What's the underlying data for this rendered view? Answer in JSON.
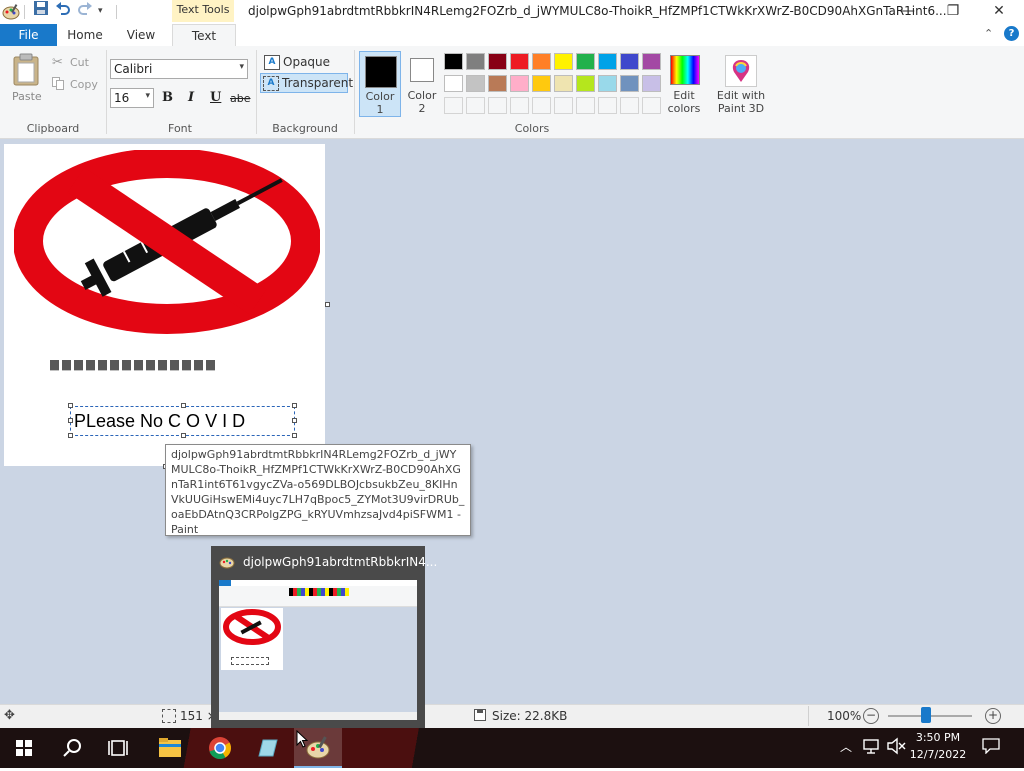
{
  "window": {
    "title": "djolpwGph91abrdtmtRbbkrIN4RLemg2FOZrb_d_jWYMULC8o-ThoikR_HfZMPf1CTWkKrXWrZ-B0CD90AhXGnTaR1int6...",
    "contextual_tab_group": "Text Tools",
    "controls": {
      "minimize": "—",
      "maximize": "❐",
      "close": "✕"
    }
  },
  "tabs": {
    "file": "File",
    "home": "Home",
    "view": "View",
    "text": "Text"
  },
  "ribbon": {
    "clipboard": {
      "paste": "Paste",
      "cut": "Cut",
      "copy": "Copy",
      "label": "Clipboard"
    },
    "font": {
      "family": "Calibri",
      "size": "16",
      "bold": "B",
      "italic": "I",
      "underline": "U",
      "strike": "abe",
      "label": "Font"
    },
    "background": {
      "opaque": "Opaque",
      "transparent": "Transparent",
      "label": "Background"
    },
    "colors": {
      "color1_line1": "Color",
      "color1_line2": "1",
      "color2_line1": "Color",
      "color2_line2": "2",
      "edit_line1": "Edit",
      "edit_line2": "colors",
      "paint3d_line1": "Edit with",
      "paint3d_line2": "Paint 3D",
      "label": "Colors",
      "color1_value": "#000000",
      "color2_value": "#ffffff",
      "palette_row1": [
        "#000000",
        "#7f7f7f",
        "#880015",
        "#ed1c24",
        "#ff7f27",
        "#fff200",
        "#22b14c",
        "#00a2e8",
        "#3f48cc",
        "#a349a4"
      ],
      "palette_row2": [
        "#ffffff",
        "#c3c3c3",
        "#b97a57",
        "#ffaec9",
        "#ffc90e",
        "#efe4b0",
        "#b5e61d",
        "#99d9ea",
        "#7092be",
        "#c8bfe7"
      ]
    }
  },
  "canvas": {
    "caption_blurred": "",
    "textbox_value": "PLease No C O V I D"
  },
  "tooltip": {
    "text": "djolpwGph91abrdtmtRbbkrIN4RLemg2FOZrb_d_jWYMULC8o-ThoikR_HfZMPf1CTWkKrXWrZ-B0CD90AhXGnTaR1int6T61vgycZVa-o569DLBOJcbsukbZeu_8KIHnVkUUGiHswEMi4uyc7LH7qBpoc5_ZYMot3U9virDRUb_oaEbDAtnQ3CRPolgZPG_kRYUVmhzsaJvd4piSFWM1 - Paint"
  },
  "preview": {
    "title": "djolpwGph91abrdtmtRbbkrIN4..."
  },
  "statusbar": {
    "dimensions": "151 ×",
    "size": "Size: 22.8KB",
    "zoom": "100%",
    "zoom_level_fraction": 0.45
  },
  "taskbar": {
    "time": "3:50 PM",
    "date": "12/7/2022"
  }
}
